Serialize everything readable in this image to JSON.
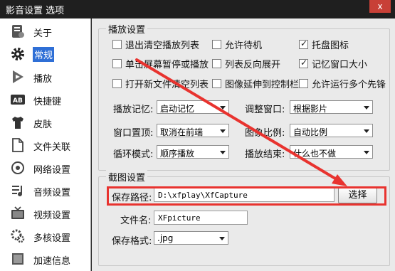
{
  "window": {
    "title": "影音设置 选项",
    "close_label": "x"
  },
  "sidebar": {
    "items": [
      {
        "label": "关于",
        "icon": "about-icon"
      },
      {
        "label": "常规",
        "icon": "gear-icon"
      },
      {
        "label": "播放",
        "icon": "play-icon"
      },
      {
        "label": "快捷键",
        "icon": "keyboard-ab-icon"
      },
      {
        "label": "皮肤",
        "icon": "tshirt-icon"
      },
      {
        "label": "文件关联",
        "icon": "file-icon"
      },
      {
        "label": "网络设置",
        "icon": "network-icon"
      },
      {
        "label": "音频设置",
        "icon": "audio-icon"
      },
      {
        "label": "视频设置",
        "icon": "video-icon"
      },
      {
        "label": "多核设置",
        "icon": "multicore-icon"
      },
      {
        "label": "加速信息",
        "icon": "accelerate-icon"
      }
    ],
    "active": "常规"
  },
  "playback": {
    "title": "播放设置",
    "checkboxes": [
      {
        "label": "退出清空播放列表",
        "checked": false
      },
      {
        "label": "允许待机",
        "checked": false
      },
      {
        "label": "托盘图标",
        "checked": true
      },
      {
        "label": "单击屏幕暂停或播放",
        "checked": false
      },
      {
        "label": "列表反向展开",
        "checked": false
      },
      {
        "label": "记忆窗口大小",
        "checked": true
      },
      {
        "label": "打开新文件清空列表",
        "checked": false
      },
      {
        "label": "图像延伸到控制栏",
        "checked": false
      },
      {
        "label": "允许运行多个先锋",
        "checked": false
      }
    ],
    "selects": [
      {
        "label": "播放记忆:",
        "value": "启动记忆"
      },
      {
        "label": "调整窗口:",
        "value": "根据影片"
      },
      {
        "label": "窗口置顶:",
        "value": "取消在前端"
      },
      {
        "label": "图象比例:",
        "value": "自动比例"
      },
      {
        "label": "循环模式:",
        "value": "顺序播放"
      },
      {
        "label": "播放结束:",
        "value": "什么也不做"
      }
    ]
  },
  "screenshot": {
    "title": "截图设置",
    "path_label": "保存路径:",
    "path_value": "D:\\xfplay\\XfCapture",
    "browse_label": "选择",
    "filename_label": "文件名:",
    "filename_value": "XFpicture",
    "format_label": "保存格式:",
    "format_value": ".jpg"
  },
  "colors": {
    "annotation": "#e8332f",
    "accent": "#2f6fd6"
  }
}
